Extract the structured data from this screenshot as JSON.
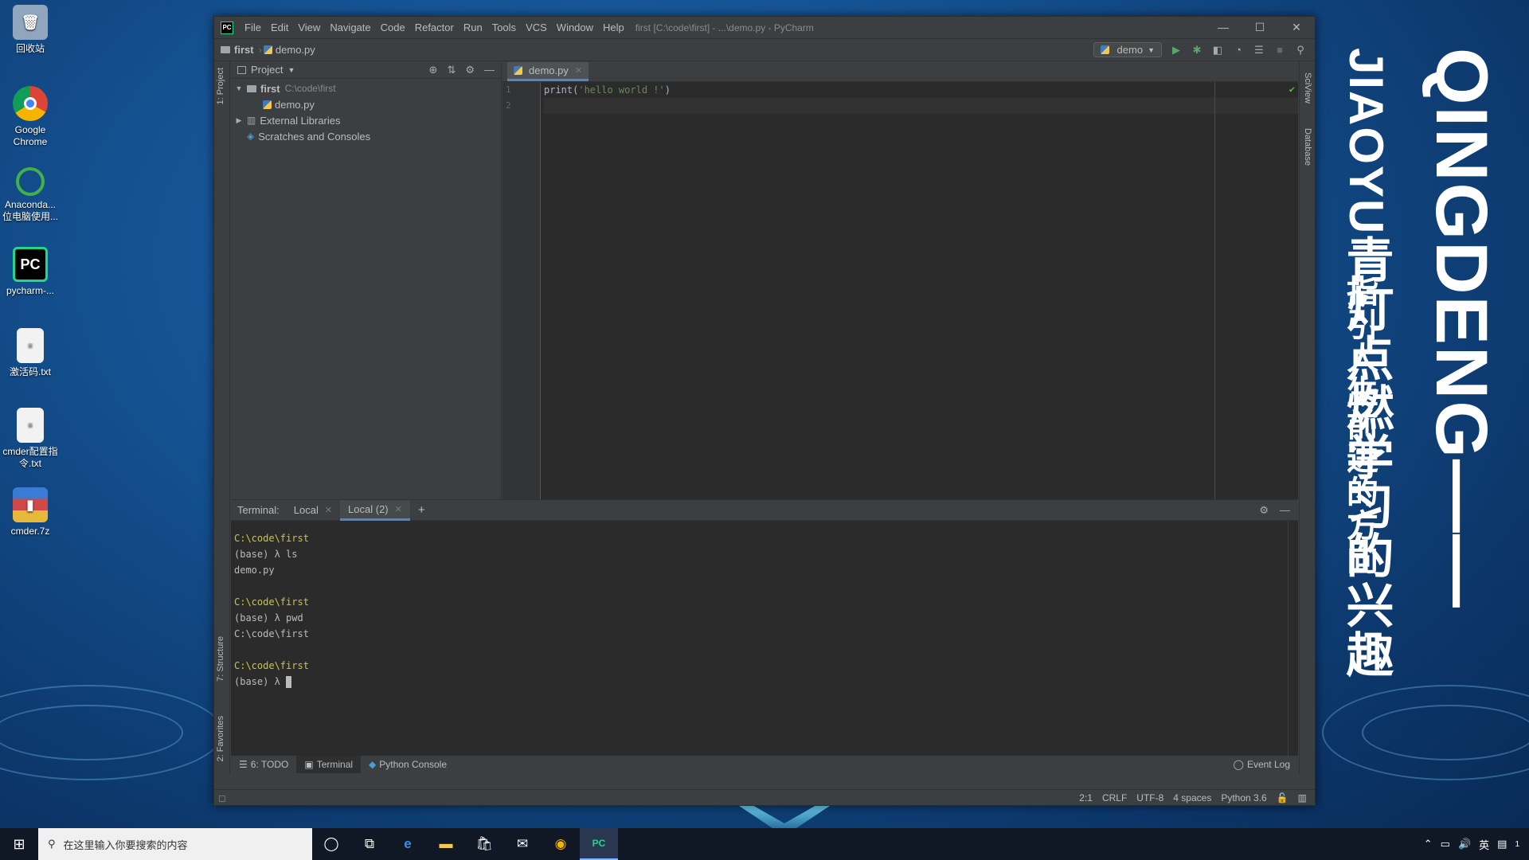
{
  "desktop": {
    "icons": [
      {
        "label": "回收站",
        "icon": "recycle-bin-icon",
        "color": "#9fb3c8"
      },
      {
        "label": "Google Chrome",
        "icon": "chrome-icon",
        "color": "#db4437"
      },
      {
        "label": "Anaconda... 位电脑使用...",
        "icon": "anaconda-icon",
        "color": "#43b049"
      },
      {
        "label": "pycharm-...",
        "icon": "pycharm-icon",
        "color": "#21d789"
      },
      {
        "label": "激活码.txt",
        "icon": "text-file-icon",
        "color": "#e8e8e8"
      },
      {
        "label": "cmder配置指令.txt",
        "icon": "text-file-icon",
        "color": "#e8e8e8"
      },
      {
        "label": "cmder.7z",
        "icon": "archive-icon",
        "color": "#3a7bd5"
      }
    ],
    "vertical_text": {
      "col1": "QINGDENG——",
      "col2": "JIAOYU青灯点燃学习的兴趣",
      "col3": "指引人生前进的方向"
    }
  },
  "window": {
    "title": "first [C:\\code\\first] - ...\\demo.py - PyCharm",
    "menu": [
      "File",
      "Edit",
      "View",
      "Navigate",
      "Code",
      "Refactor",
      "Run",
      "Tools",
      "VCS",
      "Window",
      "Help"
    ],
    "controls": {
      "minimize": "—",
      "maximize": "☐",
      "close": "✕"
    }
  },
  "navbar": {
    "crumb_project": "first",
    "crumb_file": "demo.py",
    "run_config": "demo"
  },
  "side_tabs": {
    "project": "1: Project",
    "structure": "7: Structure",
    "favorites": "2: Favorites",
    "sciview": "SciView",
    "database": "Database"
  },
  "project_pane": {
    "title": "Project",
    "tree": [
      {
        "label": "first",
        "hint": "C:\\code\\first",
        "level": 0,
        "expanded": true
      },
      {
        "label": "demo.py",
        "hint": "",
        "level": 2
      },
      {
        "label": "External Libraries",
        "hint": "",
        "level": 0,
        "expanded": false
      },
      {
        "label": "Scratches and Consoles",
        "hint": "",
        "level": 0
      }
    ]
  },
  "editor": {
    "tab": "demo.py",
    "lines": [
      {
        "num": "1",
        "code_prefix": "print(",
        "code_string": "'hello world !'",
        "code_suffix": ")"
      },
      {
        "num": "2",
        "code_prefix": "",
        "code_string": "",
        "code_suffix": ""
      }
    ]
  },
  "terminal": {
    "label": "Terminal:",
    "tabs": [
      "Local",
      "Local (2)"
    ],
    "add": "+",
    "lines": [
      {
        "text": "C:\\code\\first",
        "kind": "path"
      },
      {
        "text": "(base) λ ls",
        "kind": "text"
      },
      {
        "text": "demo.py",
        "kind": "text"
      },
      {
        "text": "",
        "kind": "text"
      },
      {
        "text": "C:\\code\\first",
        "kind": "path"
      },
      {
        "text": "(base) λ pwd",
        "kind": "text"
      },
      {
        "text": "C:\\code\\first",
        "kind": "text"
      },
      {
        "text": "",
        "kind": "text"
      },
      {
        "text": "C:\\code\\first",
        "kind": "path"
      },
      {
        "text": "(base) λ ",
        "kind": "prompt"
      }
    ]
  },
  "bottom_tools": {
    "todo": "6: TODO",
    "terminal": "Terminal",
    "python_console": "Python Console",
    "event_log": "Event Log"
  },
  "status": {
    "position": "2:1",
    "line_sep": "CRLF",
    "encoding": "UTF-8",
    "indent": "4 spaces",
    "interpreter": "Python 3.6"
  },
  "taskbar": {
    "search_placeholder": "在这里输入你要搜索的内容",
    "tray_lang": "英",
    "notification_count": "1"
  },
  "colors": {
    "accent": "#4a88c7",
    "terminal_path": "#c9c943",
    "string": "#6a8759"
  }
}
